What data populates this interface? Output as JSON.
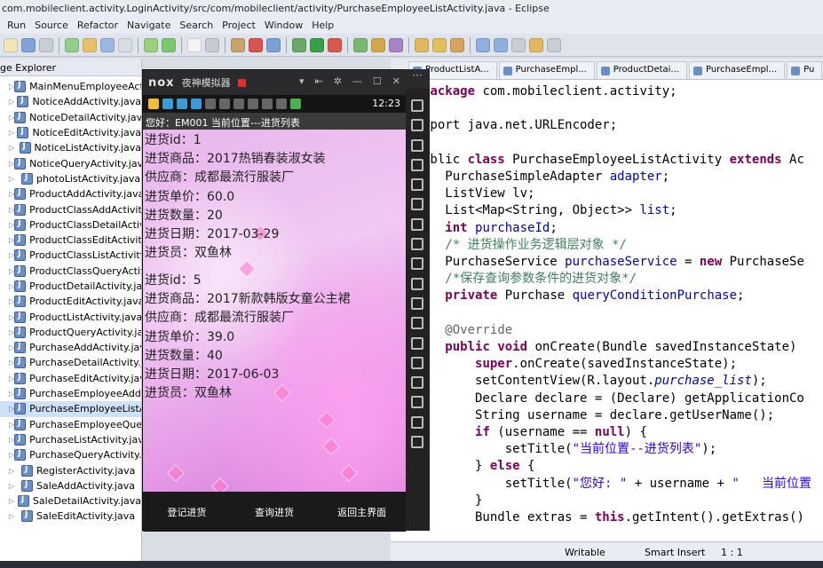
{
  "eclipse": {
    "title": "com.mobileclient.activity.LoginActivity/src/com/mobileclient/activity/PurchaseEmployeeListActivity.java - Eclipse",
    "menu": [
      "Run",
      "Source",
      "Refactor",
      "Navigate",
      "Search",
      "Project",
      "Window",
      "Help"
    ],
    "explorer_title": "ge Explorer",
    "files": [
      "MainMenuEmployeeAct",
      "NoticeAddActivity.java",
      "NoticeDetailActivity.java",
      "NoticeEditActivity.java",
      "NoticeListActivity.java",
      "NoticeQueryActivity.java",
      "photoListActivity.java",
      "ProductAddActivity.java",
      "ProductClassAddActivity",
      "ProductClassDetailActiv",
      "ProductClassEditActivity",
      "ProductClassListActivity.",
      "ProductClassQueryActivi",
      "ProductDetailActivity.java",
      "ProductEditActivity.java",
      "ProductListActivity.java",
      "ProductQueryActivity.java",
      "PurchaseAddActivity.java",
      "PurchaseDetailActivity.ja",
      "PurchaseEditActivity.java",
      "PurchaseEmployeeAddA",
      "PurchaseEmployeeListA",
      "PurchaseEmployeeQuer",
      "PurchaseListActivity.java",
      "PurchaseQueryActivity.ja",
      "RegisterActivity.java",
      "SaleAddActivity.java",
      "SaleDetailActivity.java",
      "SaleEditActivity.java"
    ],
    "editor_tabs": [
      "ProductListA...",
      "PurchaseEmpl...",
      "ProductDetai...",
      "PurchaseEmpl...",
      "Pu"
    ],
    "code": [
      "package com.mobileclient.activity;",
      "",
      "mport java.net.URLEncoder;",
      "",
      "ublic class PurchaseEmployeeListActivity extends Ac",
      "   PurchaseSimpleAdapter adapter;",
      "   ListView lv;",
      "   List<Map<String, Object>> list;",
      "   int purchaseId;",
      "   /* 进货操作业务逻辑层对象 */",
      "   PurchaseService purchaseService = new PurchaseSe",
      "   /*保存查询参数条件的进货对象*/",
      "   private Purchase queryConditionPurchase;",
      "",
      "   @Override",
      "   public void onCreate(Bundle savedInstanceState)",
      "       super.onCreate(savedInstanceState);",
      "       setContentView(R.layout.purchase_list);",
      "       Declare declare = (Declare) getApplicationCo",
      "       String username = declare.getUserName();",
      "       if (username == null) {",
      "           setTitle(\"当前位置--进货列表\");",
      "       } else {",
      "           setTitle(\"您好: \" + username + \"   当前位置",
      "       }",
      "       Bundle extras = this.getIntent().getExtras()"
    ],
    "status": {
      "writable": "Writable",
      "insert": "Smart Insert",
      "position": "1 : 1"
    }
  },
  "emulator": {
    "logo": "nox",
    "title": "夜神模拟器",
    "time": "12:23",
    "app_title": "您好：EM001  当前位置---进货列表",
    "records": [
      {
        "lines": [
          "进货id：1",
          "进货商品：2017热销春装淑女装",
          "供应商：成都最流行服装厂",
          "进货单价：60.0",
          "进货数量：20",
          "进货日期：2017-03-29",
          "进货员：双鱼林"
        ]
      },
      {
        "lines": [
          "进货id：5",
          "进货商品：2017新款韩版女童公主裙",
          "供应商：成都最流行服装厂",
          "进货单价：39.0",
          "进货数量：40",
          "进货日期：2017-06-03",
          "进货员：双鱼林"
        ]
      }
    ],
    "buttons": {
      "register": "登记进货",
      "query": "查询进货",
      "home": "返回主界面"
    }
  }
}
